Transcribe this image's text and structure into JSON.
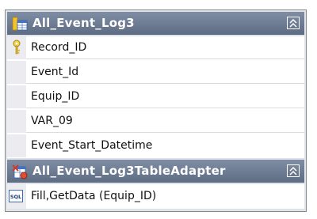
{
  "table": {
    "title": "All_Event_Log3",
    "columns": [
      "Record_ID",
      "Event_Id",
      "Equip_ID",
      "VAR_09",
      "Event_Start_Datetime"
    ],
    "primary_key": "Record_ID"
  },
  "adapter": {
    "title": "All_Event_Log3TableAdapter",
    "methods": [
      "Fill,GetData (Equip_ID)"
    ]
  }
}
